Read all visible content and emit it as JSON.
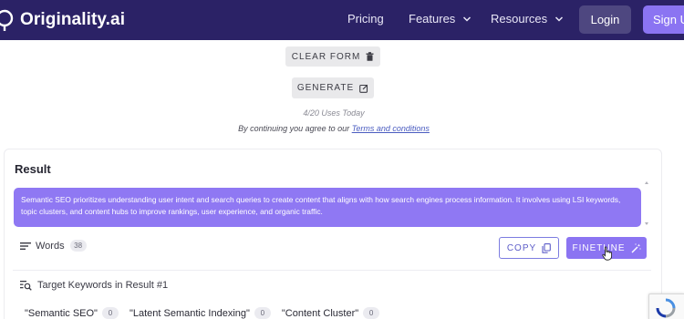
{
  "nav": {
    "brand": "Originality.ai",
    "links": [
      {
        "label": "Pricing",
        "has_dropdown": false
      },
      {
        "label": "Features",
        "has_dropdown": true
      },
      {
        "label": "Resources",
        "has_dropdown": true
      }
    ],
    "login_label": "Login",
    "signup_label": "Sign Up",
    "colors": {
      "background": "#2b2266",
      "login": "#4e4780",
      "signup": "#8b74f2"
    }
  },
  "form": {
    "clear_label": "CLEAR FORM",
    "clear_icon": "trash-icon",
    "generate_label": "GENERATE",
    "generate_icon": "edit-square-icon",
    "uses": "4/20 Uses Today",
    "agree_prefix": "By continuing you agree to our ",
    "terms_link": "Terms and conditions"
  },
  "result": {
    "title": "Result",
    "text": "Semantic SEO prioritizes understanding user intent and search queries to create content that aligns with how search engines process information. It involves using LSI keywords, topic clusters, and content hubs to improve rankings, user experience, and organic traffic.",
    "box_color": "#8f78f3",
    "words_label": "Words",
    "word_count": "38",
    "copy_label": "COPY",
    "finetune_label": "FINETUNE",
    "target_label": "Target Keywords in Result #1",
    "keywords": [
      {
        "label": "\"Semantic SEO\"",
        "count": "0"
      },
      {
        "label": "\"Latent Semantic Indexing\"",
        "count": "0"
      },
      {
        "label": "\"Content Cluster\"",
        "count": "0"
      }
    ]
  }
}
